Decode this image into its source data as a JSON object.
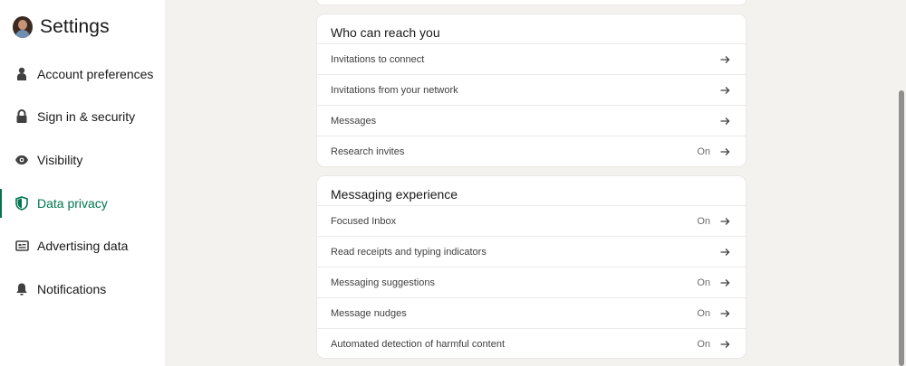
{
  "page_title": "Settings",
  "sidebar": {
    "items": [
      {
        "label": "Account preferences",
        "icon": "person-icon"
      },
      {
        "label": "Sign in & security",
        "icon": "lock-icon"
      },
      {
        "label": "Visibility",
        "icon": "eye-icon"
      },
      {
        "label": "Data privacy",
        "icon": "shield-icon",
        "active": true
      },
      {
        "label": "Advertising data",
        "icon": "ad-card-icon"
      },
      {
        "label": "Notifications",
        "icon": "bell-icon"
      }
    ]
  },
  "sections": [
    {
      "title": "Who can reach you",
      "rows": [
        {
          "label": "Invitations to connect",
          "status": ""
        },
        {
          "label": "Invitations from your network",
          "status": ""
        },
        {
          "label": "Messages",
          "status": ""
        },
        {
          "label": "Research invites",
          "status": "On"
        }
      ]
    },
    {
      "title": "Messaging experience",
      "rows": [
        {
          "label": "Focused Inbox",
          "status": "On"
        },
        {
          "label": "Read receipts and typing indicators",
          "status": ""
        },
        {
          "label": "Messaging suggestions",
          "status": "On"
        },
        {
          "label": "Message nudges",
          "status": "On"
        },
        {
          "label": "Automated detection of harmful content",
          "status": "On"
        }
      ]
    }
  ],
  "colors": {
    "accent": "#01754f",
    "background": "#f4f2ee",
    "card": "#ffffff"
  }
}
